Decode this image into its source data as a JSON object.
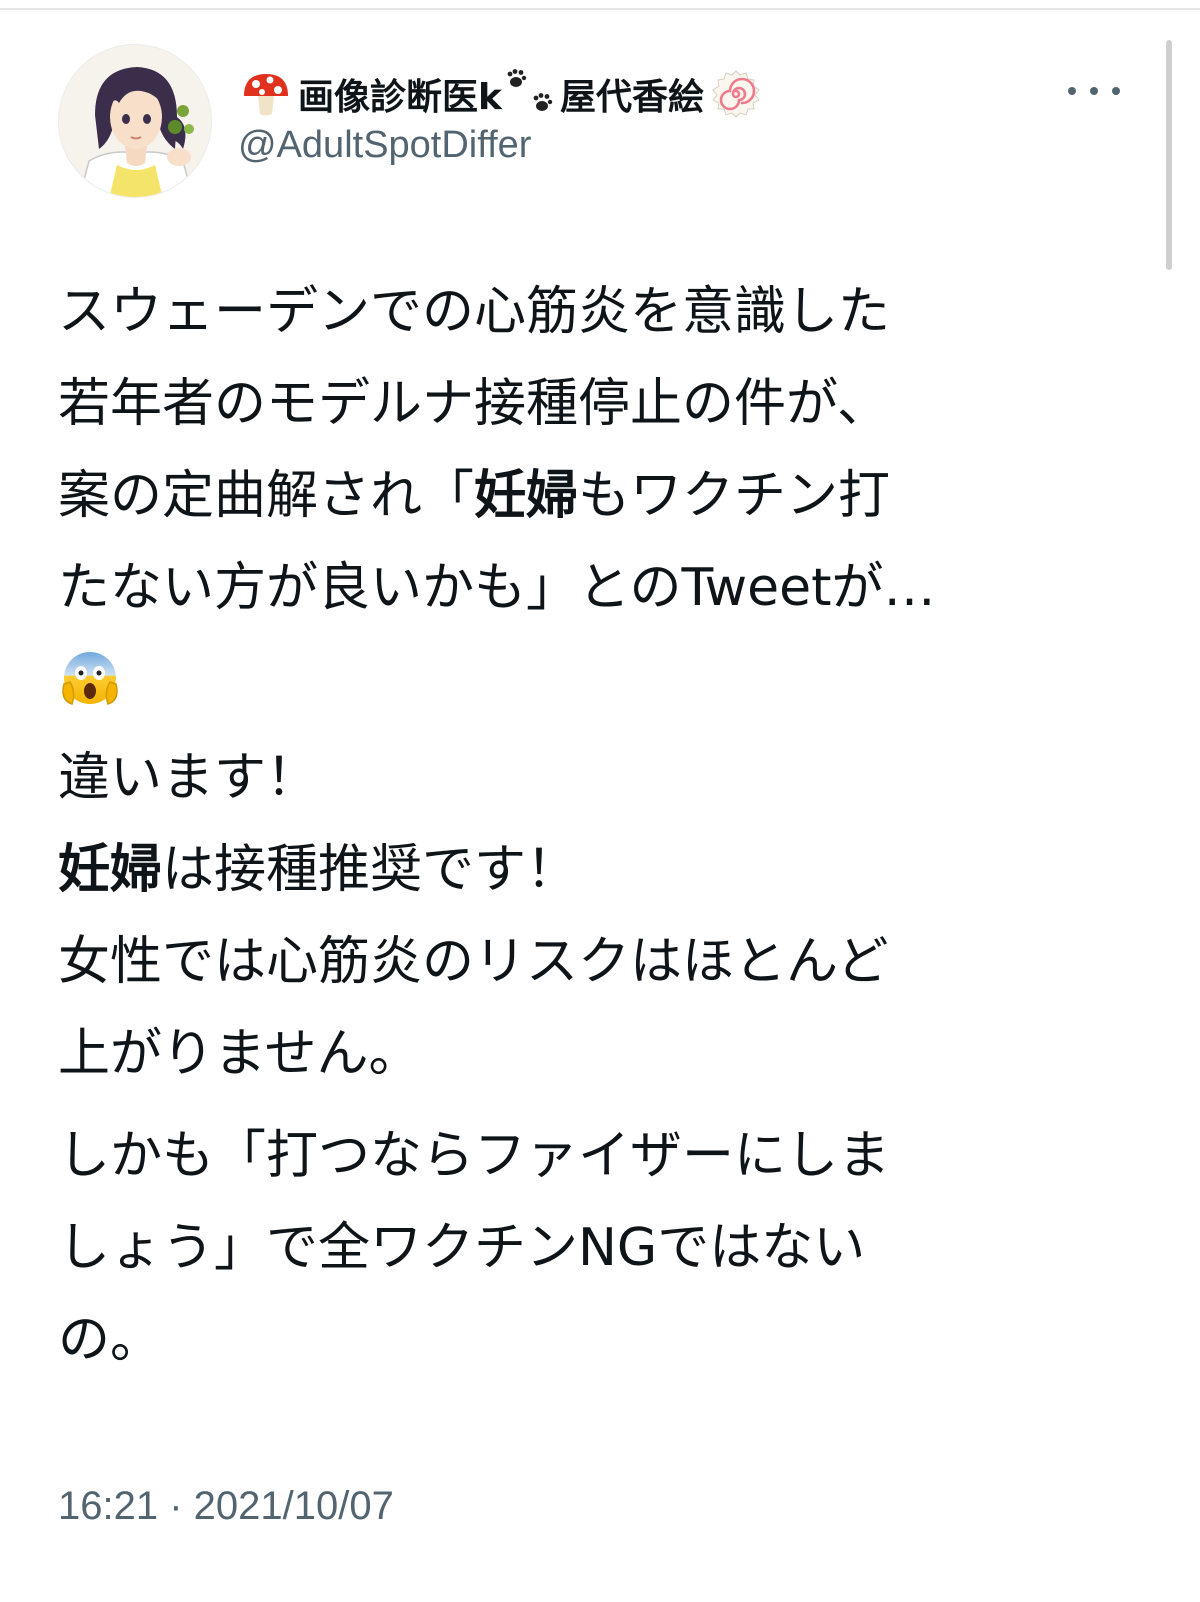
{
  "header": {
    "display_name": "画像診断医k",
    "display_name_suffix": "屋代香絵",
    "handle": "@AdultSpotDiffer",
    "more_label": "…"
  },
  "body": {
    "para1_line1": "スウェーデンでの心筋炎を意識した",
    "para1_line2": "若年者のモデルナ接種停止の件が、",
    "para1_line3a": "案の定曲解され「",
    "para1_line3b": "妊婦",
    "para1_line3c": "もワクチン打",
    "para1_line4": "たない方が良いかも」とのTweetが…",
    "para2_line1": "違います！",
    "para2_line2a": "妊婦",
    "para2_line2b": "は接種推奨です！",
    "para2_line3": "女性では心筋炎のリスクはほとんど",
    "para2_line4": "上がりません。",
    "para3_line1": "しかも「打つならファイザーにしま",
    "para3_line2": "しょう」で全ワクチンNGではない",
    "para3_line3": "の。"
  },
  "footer": {
    "timestamp": "16:21 · 2021/10/07"
  },
  "icons": {
    "name_prefix_icon": "mushroom-icon",
    "name_mid_icon": "paw-prints-icon",
    "name_suffix_icon": "narutomaki-icon",
    "body_emoji": "face-screaming-in-fear-icon"
  }
}
